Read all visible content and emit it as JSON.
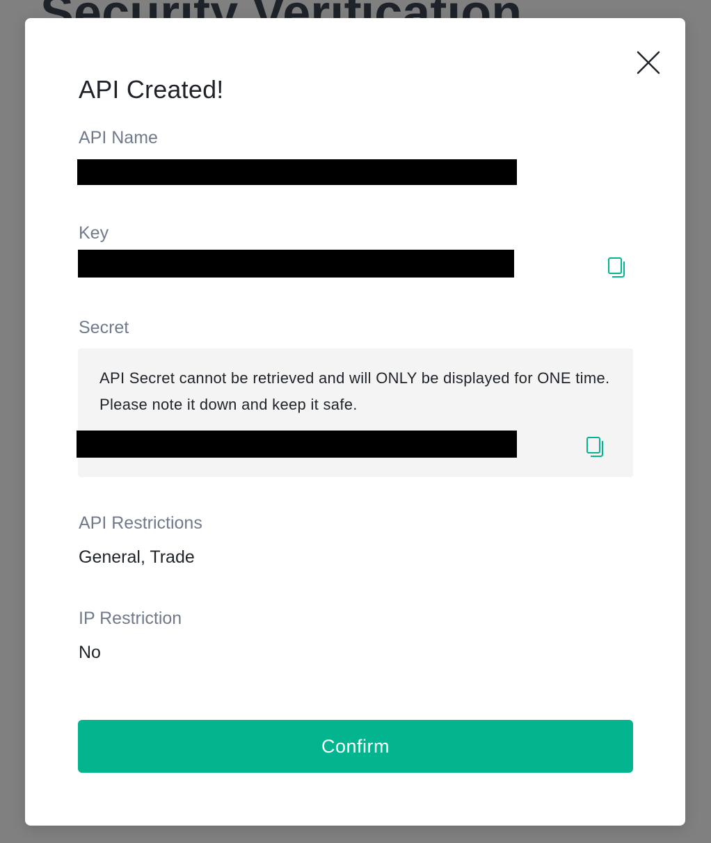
{
  "background": {
    "heading": "Security Verification"
  },
  "colors": {
    "accent": "#02b58f",
    "backdrop": "#808080",
    "label_gray": "#707a8a",
    "text_dark": "#1e2329",
    "secret_bg": "#f4f4f5"
  },
  "modal": {
    "title": "API Created!",
    "close_icon": "close-icon",
    "api_name": {
      "label": "API Name",
      "value_redacted": true
    },
    "key": {
      "label": "Key",
      "value_redacted": true,
      "copy_icon": "copy-icon"
    },
    "secret": {
      "label": "Secret",
      "note": "API Secret cannot be retrieved and will ONLY be displayed for ONE time. Please note it down and keep it safe.",
      "value_redacted": true,
      "copy_icon": "copy-icon"
    },
    "api_restrictions": {
      "label": "API Restrictions",
      "value": "General, Trade"
    },
    "ip_restriction": {
      "label": "IP Restriction",
      "value": "No"
    },
    "confirm_label": "Confirm"
  }
}
